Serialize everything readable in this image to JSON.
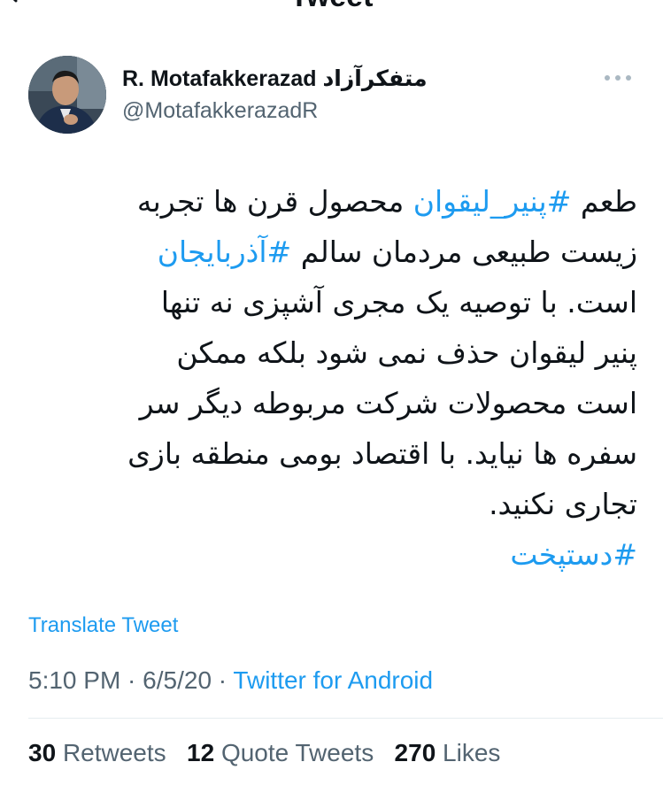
{
  "header": {
    "title": "Tweet"
  },
  "author": {
    "display_name": "R. Motafakkerazad متفکرآزاد",
    "handle": "@MotafakkerazadR"
  },
  "tweet": {
    "lines": [
      {
        "parts": [
          {
            "t": "طعم ",
            "h": false
          },
          {
            "t": "#پنیر_لیقوان",
            "h": true
          },
          {
            "t": " محصول قرن ها تجربه",
            "h": false
          }
        ]
      },
      {
        "parts": [
          {
            "t": "زیست طبیعی مردمان سالم ",
            "h": false
          },
          {
            "t": "#آذربایجان",
            "h": true
          }
        ]
      },
      {
        "parts": [
          {
            "t": "است. با توصیه یک مجری آشپزی نه تنها",
            "h": false
          }
        ]
      },
      {
        "parts": [
          {
            "t": "پنیر لیقوان حذف نمی شود بلکه ممکن",
            "h": false
          }
        ]
      },
      {
        "parts": [
          {
            "t": "است محصولات شرکت مربوطه دیگر سر",
            "h": false
          }
        ]
      },
      {
        "parts": [
          {
            "t": "سفره ها نیاید. با اقتصاد بومی منطقه بازی",
            "h": false
          }
        ]
      },
      {
        "parts": [
          {
            "t": "تجاری نکنید.",
            "h": false
          }
        ]
      },
      {
        "parts": [
          {
            "t": "#دستپخت",
            "h": true
          }
        ]
      }
    ]
  },
  "translate_label": "Translate Tweet",
  "meta": {
    "time": "5:10 PM",
    "sep1": " · ",
    "date": "6/5/20",
    "sep2": " · ",
    "source": "Twitter for Android"
  },
  "stats": {
    "retweets_count": "30",
    "retweets_label": "Retweets",
    "quotes_count": "12",
    "quotes_label": "Quote Tweets",
    "likes_count": "270",
    "likes_label": "Likes"
  },
  "colors": {
    "accent": "#1d9bf0",
    "text": "#0f1419",
    "muted": "#536471"
  },
  "icons": {
    "back": "arrow-left-icon",
    "more": "more-horizontal-icon"
  }
}
